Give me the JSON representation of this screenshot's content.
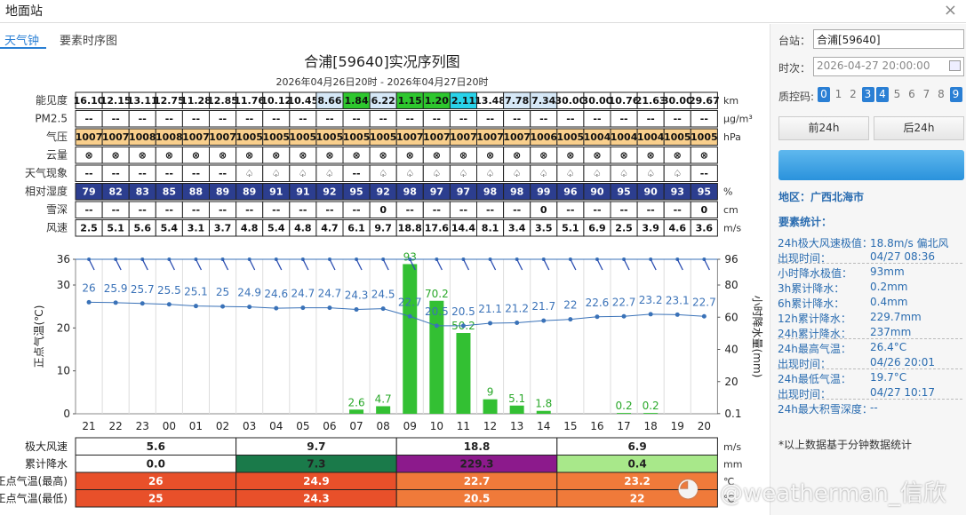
{
  "window": {
    "title": "地面站",
    "close": "×"
  },
  "tabs": [
    {
      "label": "天气钟",
      "active": true
    },
    {
      "label": "要素时序图",
      "active": false
    }
  ],
  "chart_title": "合浦[59640]实况序列图",
  "chart_subtitle": "2026年04月26日20时 - 2026年04月27日20时",
  "hours": [
    "21",
    "22",
    "23",
    "00",
    "01",
    "02",
    "03",
    "04",
    "05",
    "06",
    "07",
    "08",
    "09",
    "10",
    "11",
    "12",
    "13",
    "14",
    "15",
    "16",
    "17",
    "18",
    "19",
    "20"
  ],
  "rows": [
    {
      "label": "能见度",
      "unit": "km",
      "values": [
        "16.10",
        "12.15",
        "13.11",
        "12.75",
        "11.28",
        "12.85",
        "11.76",
        "10.12",
        "10.45",
        "8.66",
        "1.84",
        "6.22",
        "1.15",
        "1.20",
        "2.11",
        "13.48",
        "7.78",
        "7.34",
        "30.00",
        "30.00",
        "10.76",
        "21.63",
        "30.00",
        "29.67"
      ],
      "colors": [
        "#fff",
        "#fff",
        "#fff",
        "#fff",
        "#fff",
        "#fff",
        "#fff",
        "#fff",
        "#fff",
        "#d6e8f7",
        "#2ec72e",
        "#d6e8f7",
        "#2ec72e",
        "#2ec72e",
        "#29d3ea",
        "#fff",
        "#d6e8f7",
        "#d6e8f7",
        "#fff",
        "#fff",
        "#fff",
        "#fff",
        "#fff",
        "#fff"
      ]
    },
    {
      "label": "PM2.5",
      "unit": "μg/m³",
      "values": [
        "--",
        "--",
        "--",
        "--",
        "--",
        "--",
        "--",
        "--",
        "--",
        "--",
        "--",
        "--",
        "--",
        "--",
        "--",
        "--",
        "--",
        "--",
        "--",
        "--",
        "--",
        "--",
        "--",
        "--"
      ]
    },
    {
      "label": "气压",
      "unit": "hPa",
      "values": [
        "1007",
        "1007",
        "1008",
        "1008",
        "1007",
        "1007",
        "1005",
        "1005",
        "1005",
        "1005",
        "1005",
        "1005",
        "1007",
        "1007",
        "1007",
        "1007",
        "1007",
        "1006",
        "1005",
        "1004",
        "1004",
        "1004",
        "1005",
        "1005"
      ],
      "bg": "#f9cf8c"
    },
    {
      "label": "云量",
      "unit": "",
      "values": [
        "⊗",
        "⊗",
        "⊗",
        "⊗",
        "⊗",
        "⊗",
        "⊗",
        "⊗",
        "⊗",
        "⊗",
        "⊗",
        "⊗",
        "⊗",
        "⊗",
        "⊗",
        "⊗",
        "⊗",
        "⊗",
        "⊗",
        "⊗",
        "⊗",
        "⊗",
        "⊗",
        "⊗"
      ]
    },
    {
      "label": "天气现象",
      "unit": "",
      "values": [
        "--",
        "--",
        "--",
        "--",
        "--",
        "--",
        "♤",
        "♤",
        "♤",
        "♤",
        "--",
        "♤",
        "♤",
        "♤",
        "♤",
        "♤",
        "♤",
        "♤",
        "♤",
        "♤",
        "♤",
        "♤",
        "♤",
        "--"
      ]
    },
    {
      "label": "相对湿度",
      "unit": "%",
      "values": [
        "79",
        "82",
        "83",
        "85",
        "88",
        "89",
        "89",
        "91",
        "91",
        "92",
        "95",
        "92",
        "98",
        "97",
        "97",
        "98",
        "98",
        "99",
        "96",
        "90",
        "95",
        "90",
        "93",
        "95"
      ],
      "bg": "#2c3e8f"
    },
    {
      "label": "雪深",
      "unit": "cm",
      "values": [
        "--",
        "--",
        "--",
        "--",
        "--",
        "--",
        "--",
        "--",
        "--",
        "--",
        "--",
        "0",
        "--",
        "--",
        "--",
        "--",
        "--",
        "0",
        "--",
        "--",
        "--",
        "--",
        "--",
        "0"
      ]
    },
    {
      "label": "风速",
      "unit": "m/s",
      "values": [
        "2.5",
        "5.1",
        "5.6",
        "5.4",
        "3.1",
        "3.7",
        "4.8",
        "5.4",
        "4.8",
        "4.7",
        "6.1",
        "9.7",
        "18.8",
        "17.6",
        "14.4",
        "8.1",
        "3.4",
        "3.5",
        "5.1",
        "6.9",
        "2.5",
        "3.9",
        "4.6",
        "3.6"
      ]
    }
  ],
  "chart_data": {
    "type": "line",
    "x": [
      "21",
      "22",
      "23",
      "00",
      "01",
      "02",
      "03",
      "04",
      "05",
      "06",
      "07",
      "08",
      "09",
      "10",
      "11",
      "12",
      "13",
      "14",
      "15",
      "16",
      "17",
      "18",
      "19",
      "20"
    ],
    "series": [
      {
        "name": "",
        "axis": "left",
        "values": [
          26,
          25.9,
          25.7,
          25.5,
          25.1,
          25,
          24.9,
          24.6,
          24.7,
          24.7,
          24.3,
          24.5,
          22.7,
          20.5,
          20.5,
          21.1,
          21.2,
          21.7,
          22,
          22.6,
          22.7,
          23.2,
          23.1,
          22.7
        ],
        "color": "#2a6cb0"
      },
      {
        "name": "",
        "axis": "right",
        "type": "bar",
        "values": [
          null,
          null,
          null,
          null,
          null,
          null,
          null,
          null,
          null,
          null,
          2.6,
          4.7,
          93,
          70.2,
          50.2,
          9,
          5.1,
          1.8,
          null,
          null,
          0.2,
          0.2,
          null,
          null
        ],
        "color": "#3cc43c"
      }
    ],
    "ylabel_left": "正点气温(℃)",
    "ylim_left": [
      0,
      36
    ],
    "yticks_left": [
      0,
      10,
      20,
      30,
      36
    ],
    "ylabel_right": "小时降水量(mm)",
    "ylim_right": [
      0.1,
      96
    ],
    "yticks_right": [
      "0.1",
      "20",
      "40",
      "60",
      "80",
      "96"
    ],
    "wind_barbs": true,
    "grid": true
  },
  "summary": {
    "rows": [
      {
        "label": "极大风速",
        "unit": "m/s",
        "cells": [
          {
            "v": "5.6",
            "bg": "#fff",
            "fg": "#222"
          },
          {
            "v": "9.7",
            "bg": "#fff",
            "fg": "#222"
          },
          {
            "v": "18.8",
            "bg": "#fff",
            "fg": "#222"
          },
          {
            "v": "6.9",
            "bg": "#fff",
            "fg": "#222"
          }
        ]
      },
      {
        "label": "累计降水",
        "unit": "mm",
        "cells": [
          {
            "v": "0.0",
            "bg": "#fff",
            "fg": "#222"
          },
          {
            "v": "7.3",
            "bg": "#1a7a4a",
            "fg": "#222"
          },
          {
            "v": "229.3",
            "bg": "#8c1a8c",
            "fg": "#222"
          },
          {
            "v": "0.4",
            "bg": "#a8e88a",
            "fg": "#222"
          }
        ]
      },
      {
        "label": "正点气温(最高)",
        "unit": "℃",
        "cells": [
          {
            "v": "26",
            "bg": "#e8502a",
            "fg": "#fff"
          },
          {
            "v": "24.9",
            "bg": "#e8502a",
            "fg": "#fff"
          },
          {
            "v": "22.7",
            "bg": "#f07a3a",
            "fg": "#fff"
          },
          {
            "v": "23.2",
            "bg": "#f07a3a",
            "fg": "#fff"
          }
        ]
      },
      {
        "label": "正点气温(最低)",
        "unit": "℃",
        "cells": [
          {
            "v": "25",
            "bg": "#e8502a",
            "fg": "#fff"
          },
          {
            "v": "24.3",
            "bg": "#e8502a",
            "fg": "#fff"
          },
          {
            "v": "20.5",
            "bg": "#f07a3a",
            "fg": "#fff"
          },
          {
            "v": "22",
            "bg": "#f07a3a",
            "fg": "#fff"
          }
        ]
      }
    ]
  },
  "panel": {
    "station_label": "台站：",
    "station_value": "合浦[59640]",
    "time_label": "时次：",
    "time_value": "2026-04-27 20:00:00",
    "qc_label": "质控码:",
    "qc_codes": [
      {
        "n": "0",
        "on": true
      },
      {
        "n": "1",
        "on": false
      },
      {
        "n": "2",
        "on": false
      },
      {
        "n": "3",
        "on": true
      },
      {
        "n": "4",
        "on": true
      },
      {
        "n": "5",
        "on": false
      },
      {
        "n": "6",
        "on": false
      },
      {
        "n": "7",
        "on": false
      },
      {
        "n": "8",
        "on": false
      },
      {
        "n": "9",
        "on": true
      }
    ],
    "prev_btn": "前24h",
    "next_btn": "后24h",
    "region": "地区：广西北海市",
    "stats_title": "要素统计：",
    "stats": [
      {
        "k": "24h极大风速极值：",
        "v": "18.8m/s 偏北风"
      },
      {
        "k": "出现时间：",
        "v": "04/27 08:36"
      },
      {
        "k": "小时降水极值：",
        "v": "93mm"
      },
      {
        "k": "3h累计降水：",
        "v": "0.2mm"
      },
      {
        "k": "6h累计降水：",
        "v": "0.4mm"
      },
      {
        "k": "12h累计降水：",
        "v": "229.7mm"
      },
      {
        "k": "24h累计降水：",
        "v": "237mm"
      },
      {
        "k": "24h最高气温：",
        "v": "26.4°C"
      },
      {
        "k": "出现时间：",
        "v": "04/26 20:01"
      },
      {
        "k": "24h最低气温：",
        "v": "19.7°C"
      },
      {
        "k": "出现时间：",
        "v": "04/27 10:17"
      },
      {
        "k": "24h最大积雪深度：",
        "v": "--"
      }
    ],
    "note": "*以上数据基于分钟数据统计"
  },
  "watermark": "@weatherman_信欣"
}
